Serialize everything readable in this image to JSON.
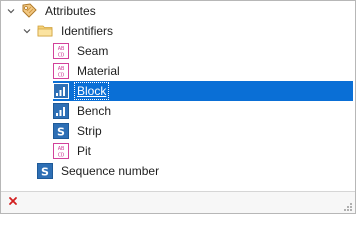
{
  "tree": {
    "root": {
      "label": "Attributes",
      "expanded": true,
      "icon": "tag-icon"
    },
    "folder": {
      "label": "Identifiers",
      "expanded": true,
      "icon": "folder-icon"
    },
    "children": [
      {
        "label": "Seam",
        "icon": "text-field-icon",
        "selected": false
      },
      {
        "label": "Material",
        "icon": "text-field-icon",
        "selected": false
      },
      {
        "label": "Block",
        "icon": "numeric-field-icon",
        "selected": true
      },
      {
        "label": "Bench",
        "icon": "numeric-field-icon",
        "selected": false
      },
      {
        "label": "Strip",
        "icon": "sequence-icon",
        "selected": false
      },
      {
        "label": "Pit",
        "icon": "text-field-icon",
        "selected": false
      }
    ],
    "sequence": {
      "label": "Sequence number",
      "icon": "sequence-icon"
    }
  },
  "colors": {
    "selection": "#0a6fd6",
    "text_field_icon": "#d2429b",
    "numeric_icon": "#2e6fb5",
    "close": "#d21e1e"
  },
  "footer": {
    "close_icon": "close-icon",
    "grip_icon": "resize-grip-icon"
  }
}
